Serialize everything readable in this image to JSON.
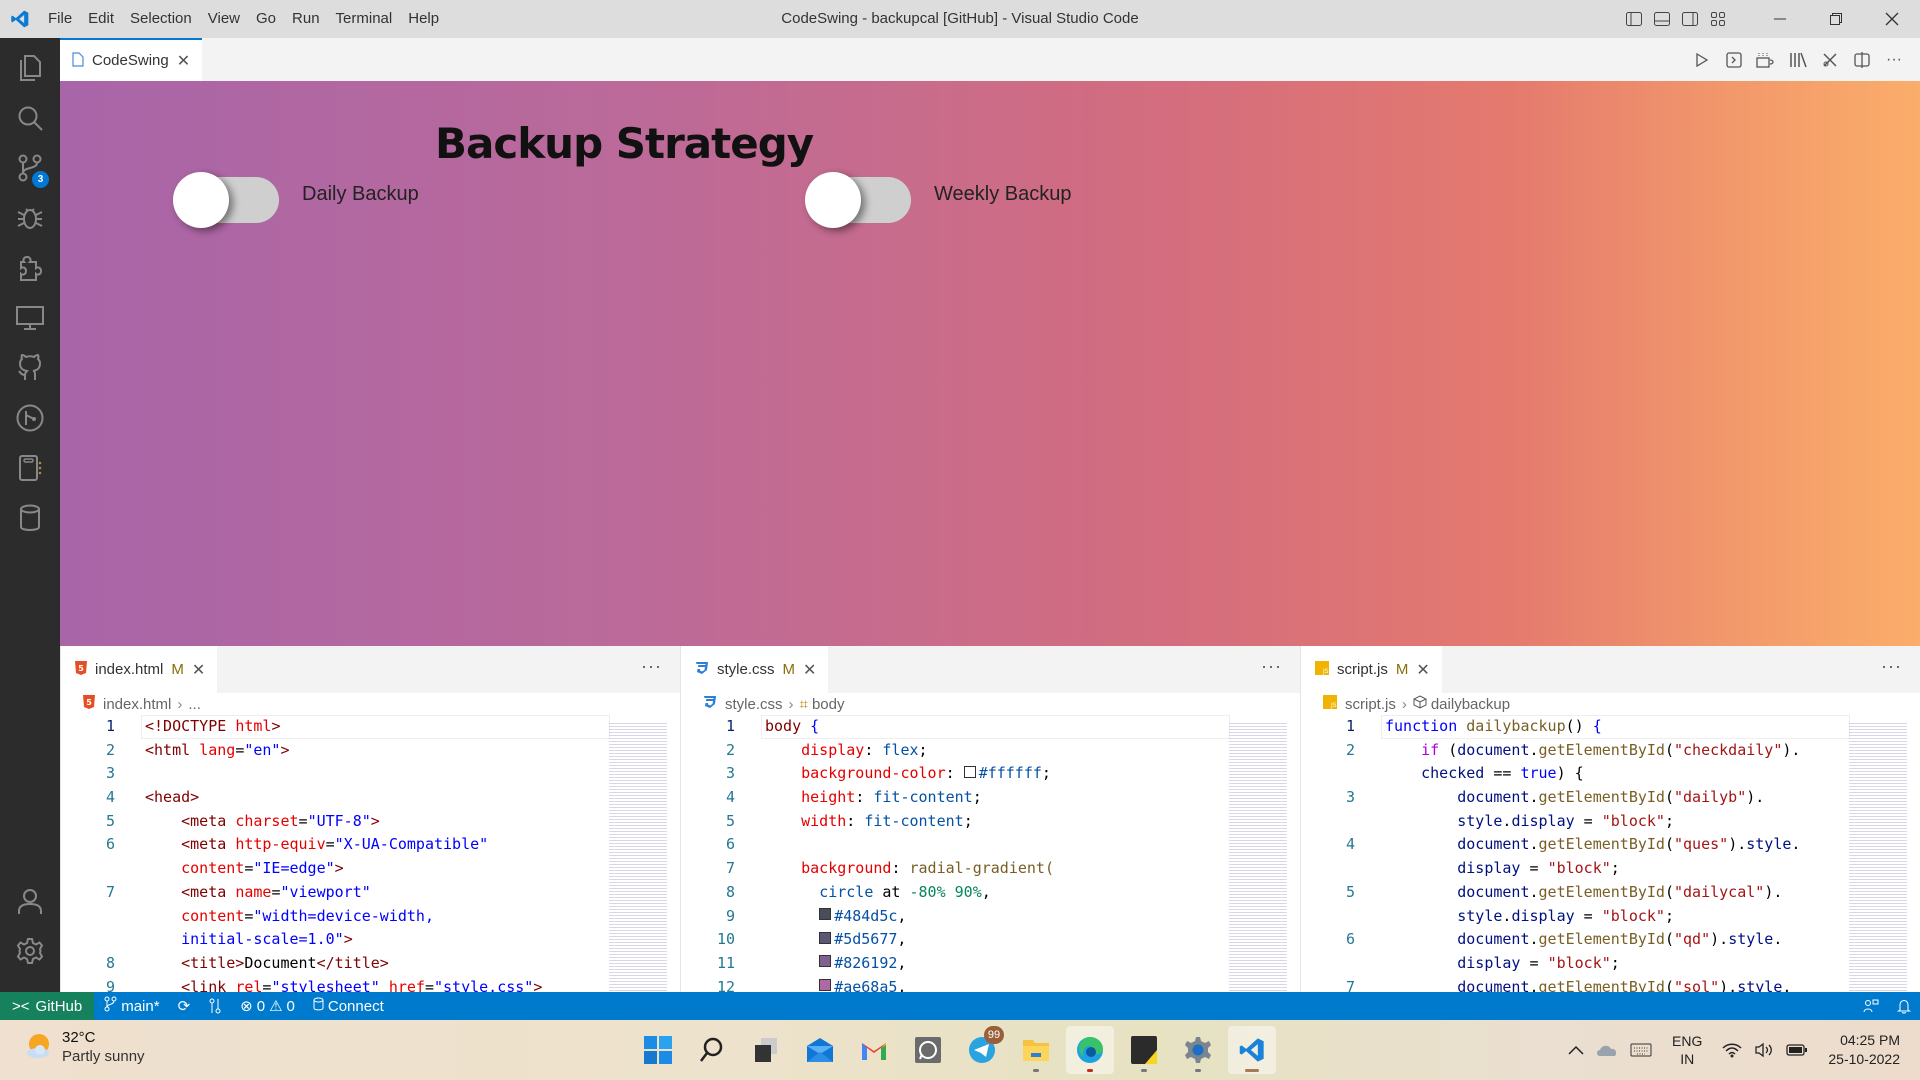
{
  "titlebar": {
    "menu": [
      "File",
      "Edit",
      "Selection",
      "View",
      "Go",
      "Run",
      "Terminal",
      "Help"
    ],
    "window_title": "CodeSwing - backupcal [GitHub] - Visual Studio Code"
  },
  "activity_bar": {
    "items": [
      {
        "icon": "explorer-icon"
      },
      {
        "icon": "search-icon"
      },
      {
        "icon": "source-control-icon",
        "badge": "3"
      },
      {
        "icon": "run-debug-icon"
      },
      {
        "icon": "extensions-icon"
      },
      {
        "icon": "remote-explorer-icon"
      },
      {
        "icon": "github-icon"
      },
      {
        "icon": "git-graph-icon"
      },
      {
        "icon": "notebook-icon"
      },
      {
        "icon": "database-icon"
      }
    ],
    "bottom": [
      {
        "icon": "account-icon"
      },
      {
        "icon": "settings-gear-icon"
      }
    ]
  },
  "top_tab": {
    "label": "CodeSwing"
  },
  "preview": {
    "title": "Backup Strategy",
    "toggles": [
      {
        "label": "Daily Backup",
        "checked": false
      },
      {
        "label": "Weekly Backup",
        "checked": false
      }
    ],
    "gradient_colors": [
      "#a865a8",
      "#d46d7e",
      "#fbad6a"
    ]
  },
  "editors": [
    {
      "file": "index.html",
      "modified": "M",
      "breadcrumb": [
        "index.html",
        "..."
      ],
      "lines": [
        {
          "n": "1",
          "html": "<span class='tag'>&lt;!DOCTYPE</span> <span class='attr'>html</span><span class='tag'>&gt;</span>"
        },
        {
          "n": "2",
          "html": "<span class='tag'>&lt;html</span> <span class='attr'>lang</span>=<span class='str'>\"en\"</span><span class='tag'>&gt;</span>"
        },
        {
          "n": "3",
          "html": ""
        },
        {
          "n": "4",
          "html": "<span class='tag'>&lt;head&gt;</span>"
        },
        {
          "n": "5",
          "html": "    <span class='tag'>&lt;meta</span> <span class='attr'>charset</span>=<span class='str'>\"UTF-8\"</span><span class='tag'>&gt;</span>"
        },
        {
          "n": "6",
          "html": "    <span class='tag'>&lt;meta</span> <span class='attr'>http-equiv</span>=<span class='str'>\"X-UA-Compatible\"</span>"
        },
        {
          "n": "",
          "html": "    <span class='attr'>content</span>=<span class='str'>\"IE=edge\"</span><span class='tag'>&gt;</span>"
        },
        {
          "n": "7",
          "html": "    <span class='tag'>&lt;meta</span> <span class='attr'>name</span>=<span class='str'>\"viewport\"</span>"
        },
        {
          "n": "",
          "html": "    <span class='attr'>content</span>=<span class='str'>\"width=device-width,</span>"
        },
        {
          "n": "",
          "html": "    <span class='str'>initial-scale=1.0\"</span><span class='tag'>&gt;</span>"
        },
        {
          "n": "8",
          "html": "    <span class='tag'>&lt;title&gt;</span>Document<span class='tag'>&lt;/title&gt;</span>"
        },
        {
          "n": "9",
          "html": "    <span class='tag'>&lt;link</span> <span class='attr'>rel</span>=<span class='str'>\"stylesheet\"</span> <span class='attr'>href</span>=<span class='str'>\"style.css\"</span><span class='tag'>&gt;</span>"
        }
      ]
    },
    {
      "file": "style.css",
      "modified": "M",
      "breadcrumb": [
        "style.css",
        "body"
      ],
      "lines": [
        {
          "n": "1",
          "html": "<span class='tag'>body</span> <span class='kw'>{</span>"
        },
        {
          "n": "2",
          "html": "    <span class='prop'>display</span>: <span class='val'>flex</span>;"
        },
        {
          "n": "3",
          "html": "    <span class='prop'>background-color</span>: <span class='swatch' style='background:#ffffff'></span><span class='val'>#ffffff</span>;"
        },
        {
          "n": "4",
          "html": "    <span class='prop'>height</span>: <span class='val'>fit-content</span>;"
        },
        {
          "n": "5",
          "html": "    <span class='prop'>width</span>: <span class='val'>fit-content</span>;"
        },
        {
          "n": "6",
          "html": ""
        },
        {
          "n": "7",
          "html": "    <span class='prop'>background</span>: <span class='fn'>radial-gradient(</span>"
        },
        {
          "n": "8",
          "html": "      <span class='val'>circle</span> at <span class='num'>-80% 90%</span>,"
        },
        {
          "n": "9",
          "html": "      <span class='swatch' style='background:#484d5c'></span><span class='val'>#484d5c</span>,"
        },
        {
          "n": "10",
          "html": "      <span class='swatch' style='background:#5d5677'></span><span class='val'>#5d5677</span>,"
        },
        {
          "n": "11",
          "html": "      <span class='swatch' style='background:#826192'></span><span class='val'>#826192</span>,"
        },
        {
          "n": "12",
          "html": "      <span class='swatch' style='background:#ae68a5'></span><span class='val'>#ae68a5</span>,"
        }
      ]
    },
    {
      "file": "script.js",
      "modified": "M",
      "breadcrumb": [
        "script.js",
        "dailybackup"
      ],
      "lines": [
        {
          "n": "1",
          "html": "<span class='kw'>function</span> <span class='fn'>dailybackup</span>() <span class='kw'>{</span>"
        },
        {
          "n": "2",
          "html": "    <span class='kw' style='color:#af00db'>if</span> (<span class='var'>document</span>.<span class='fn'>getElementById</span>(<span class='jstr'>\"checkdaily\"</span>)."
        },
        {
          "n": "",
          "html": "    <span class='var'>checked</span> == <span class='kw'>true</span>) {"
        },
        {
          "n": "3",
          "html": "        <span class='var'>document</span>.<span class='fn'>getElementById</span>(<span class='jstr'>\"dailyb\"</span>)."
        },
        {
          "n": "",
          "html": "        <span class='var'>style</span>.<span class='var'>display</span> = <span class='jstr'>\"block\"</span>;"
        },
        {
          "n": "4",
          "html": "        <span class='var'>document</span>.<span class='fn'>getElementById</span>(<span class='jstr'>\"ques\"</span>).<span class='var'>style</span>."
        },
        {
          "n": "",
          "html": "        <span class='var'>display</span> = <span class='jstr'>\"block\"</span>;"
        },
        {
          "n": "5",
          "html": "        <span class='var'>document</span>.<span class='fn'>getElementById</span>(<span class='jstr'>\"dailycal\"</span>)."
        },
        {
          "n": "",
          "html": "        <span class='var'>style</span>.<span class='var'>display</span> = <span class='jstr'>\"block\"</span>;"
        },
        {
          "n": "6",
          "html": "        <span class='var'>document</span>.<span class='fn'>getElementById</span>(<span class='jstr'>\"qd\"</span>).<span class='var'>style</span>."
        },
        {
          "n": "",
          "html": "        <span class='var'>display</span> = <span class='jstr'>\"block\"</span>;"
        },
        {
          "n": "7",
          "html": "        <span class='var'>document</span>.<span class='fn'>getElementById</span>(<span class='jstr'>\"sol\"</span>).<span class='var'>style</span>."
        }
      ]
    }
  ],
  "statusbar": {
    "remote": "GitHub",
    "branch": "main*",
    "errors": "0",
    "warnings": "0",
    "connect": "Connect"
  },
  "taskbar": {
    "weather_temp": "32°C",
    "weather_desc": "Partly sunny",
    "apps": [
      {
        "name": "start-button",
        "icon": "windows-icon"
      },
      {
        "name": "search-button",
        "icon": "search-icon"
      },
      {
        "name": "task-view-button",
        "icon": "task-view-icon"
      },
      {
        "name": "mail-app",
        "icon": "mail-icon"
      },
      {
        "name": "gmail-app",
        "icon": "gmail-icon"
      },
      {
        "name": "whatsapp-app",
        "icon": "whatsapp-icon"
      },
      {
        "name": "telegram-app",
        "icon": "telegram-icon",
        "badge": "99"
      },
      {
        "name": "file-explorer-app",
        "icon": "folder-icon"
      },
      {
        "name": "edge-app",
        "icon": "edge-icon"
      },
      {
        "name": "sticky-notes-app",
        "icon": "sticky-notes-icon"
      },
      {
        "name": "settings-app",
        "icon": "settings-icon"
      },
      {
        "name": "vscode-app",
        "icon": "vscode-icon"
      }
    ],
    "lang_line1": "ENG",
    "lang_line2": "IN",
    "time": "04:25 PM",
    "date": "25-10-2022"
  }
}
